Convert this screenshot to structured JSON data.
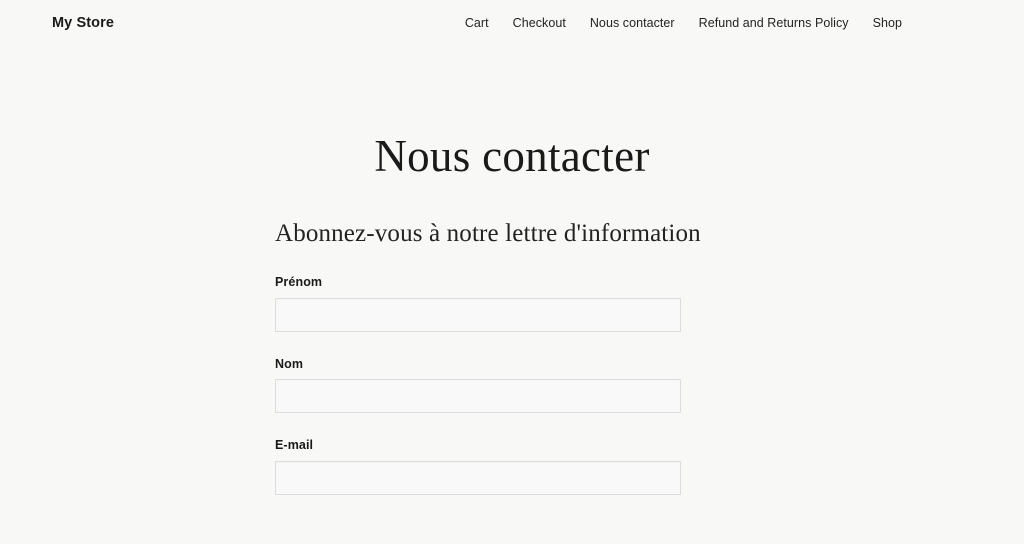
{
  "header": {
    "logo": "My Store",
    "nav": [
      {
        "label": "Cart"
      },
      {
        "label": "Checkout"
      },
      {
        "label": "Nous contacter"
      },
      {
        "label": "Refund and Returns Policy"
      },
      {
        "label": "Shop"
      }
    ]
  },
  "main": {
    "page_title": "Nous contacter",
    "form": {
      "subtitle": "Abonnez-vous à notre lettre d'information",
      "fields": [
        {
          "label": "Prénom",
          "value": "",
          "placeholder": ""
        },
        {
          "label": "Nom",
          "value": "",
          "placeholder": ""
        },
        {
          "label": "E-mail",
          "value": "",
          "placeholder": ""
        }
      ]
    }
  },
  "colors": {
    "page_background": "#f8f8f7",
    "text": "#1a1a1a",
    "input_border": "#dcdcdc",
    "input_background": "#f9f9f9"
  }
}
